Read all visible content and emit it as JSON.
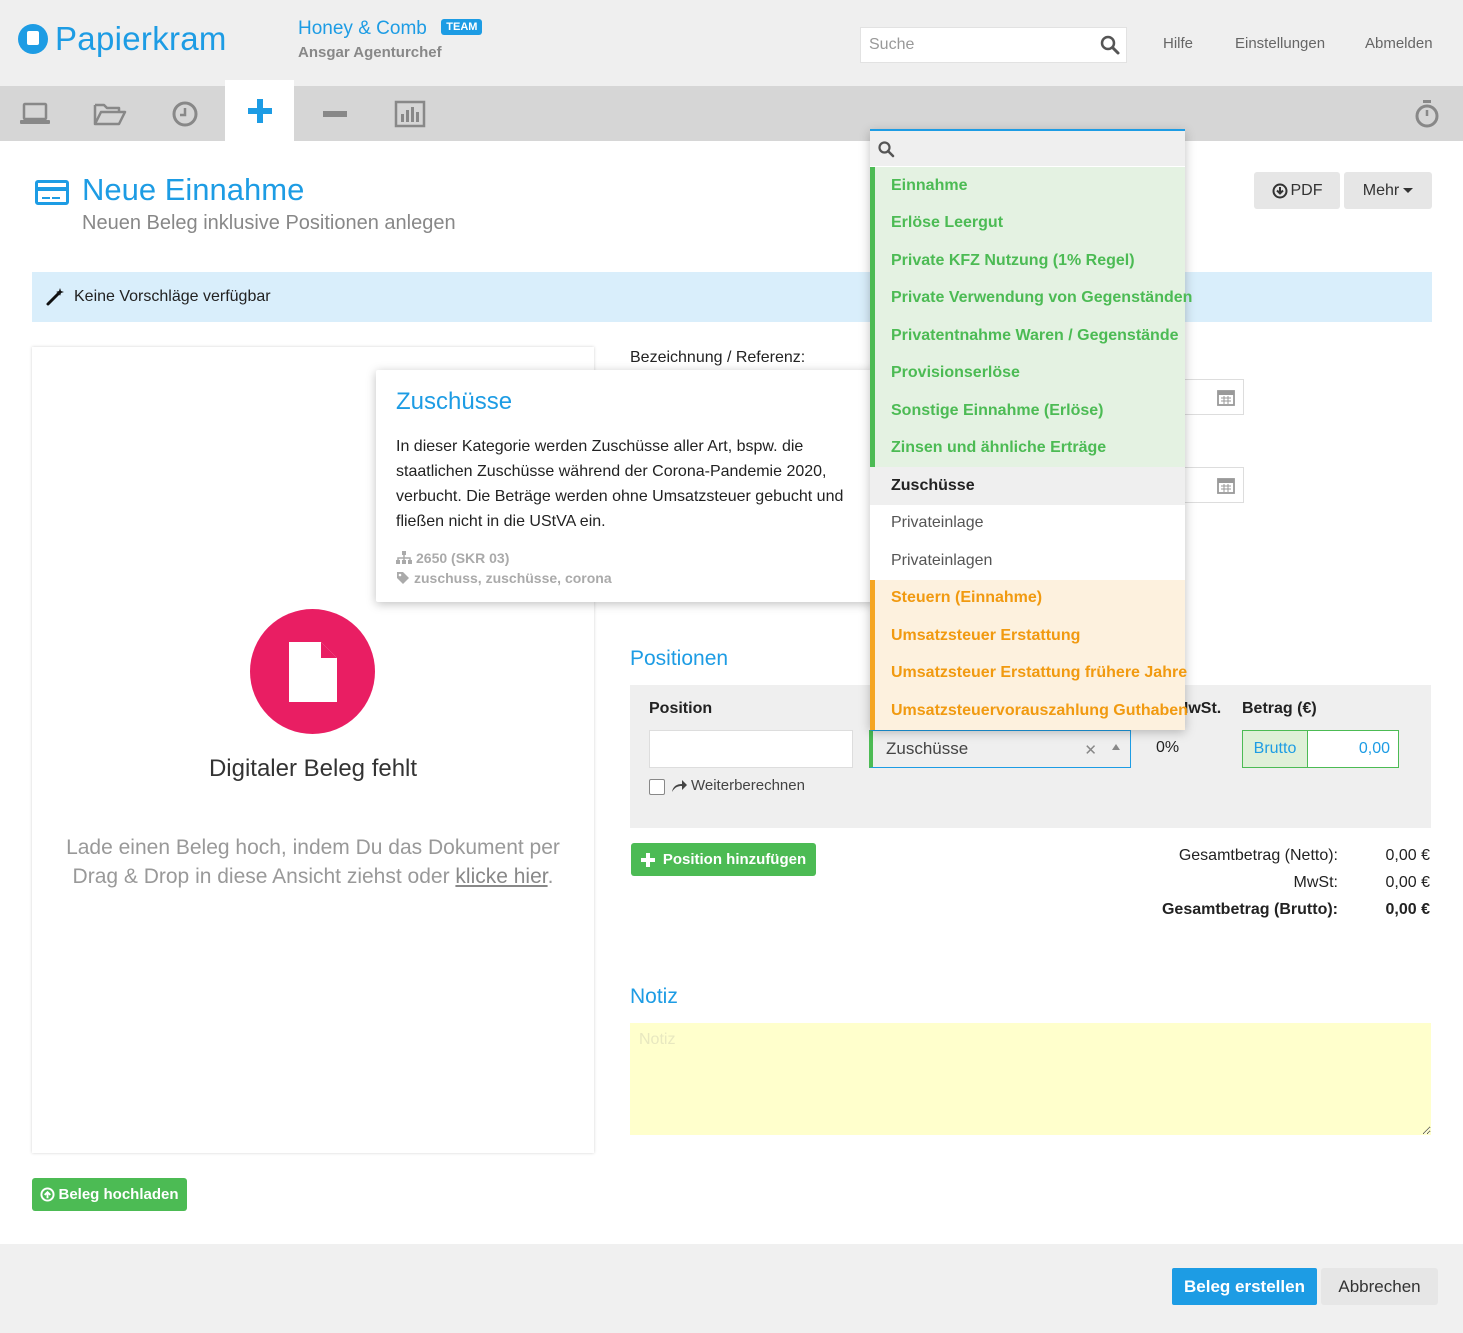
{
  "header": {
    "logo_text": "Papierkram",
    "company_name": "Honey & Comb",
    "team_badge": "TEAM",
    "user_name": "Ansgar Agenturchef",
    "search_placeholder": "Suche",
    "links": [
      "Hilfe",
      "Einstellungen",
      "Abmelden"
    ]
  },
  "toolbar": {
    "items": [
      "laptop-icon",
      "folder-open-icon",
      "clock-icon",
      "plus-icon",
      "minus-icon",
      "bar-chart-icon"
    ],
    "active": "plus-icon",
    "right_icon": "stopwatch-icon"
  },
  "page": {
    "title": "Neue Einnahme",
    "subtitle": "Neuen Beleg inklusive Positionen anlegen",
    "pdf_button": "PDF",
    "more_button": "Mehr"
  },
  "suggestion": {
    "text": "Keine Vorschläge verfügbar"
  },
  "upload": {
    "missing_title": "Digitaler Beleg fehlt",
    "hint_text": "Lade einen Beleg hoch, indem Du das Dokument per Drag & Drop in diese Ansicht ziehst oder ",
    "hint_link": "klicke hier",
    "hint_end": ".",
    "upload_button": "Beleg hochladen"
  },
  "form": {
    "reference_label": "Bezeichnung / Referenz:"
  },
  "positions": {
    "title": "Positionen",
    "col_position": "Position",
    "col_mwst": "MwSt.",
    "col_betrag": "Betrag (€)",
    "position_value": "",
    "category_value": "Zuschüsse",
    "mwst_value": "0%",
    "brutto_label": "Brutto",
    "amount_value": "0,00",
    "recalc_label": "Weiterberechnen",
    "add_button": "Position hinzufügen"
  },
  "totals": {
    "net_label": "Gesamtbetrag (Netto):",
    "net_value": "0,00 €",
    "vat_label": "MwSt:",
    "vat_value": "0,00 €",
    "gross_label": "Gesamtbetrag (Brutto):",
    "gross_value": "0,00 €"
  },
  "note": {
    "title": "Notiz",
    "placeholder": "Notiz",
    "value": ""
  },
  "popover": {
    "title": "Zuschüsse",
    "body": "In dieser Kategorie werden Zuschüsse aller Art, bspw. die staatlichen Zuschüsse während der Corona-Pandemie 2020, verbucht. Die Beträge werden ohne Umsatzsteuer gebucht und fließen nicht in die UStVA ein.",
    "account": "2650 (SKR 03)",
    "tags": "zuschuss, zuschüsse, corona"
  },
  "dropdown": {
    "search_value": "",
    "items": [
      {
        "label": "Einnahme",
        "group": "green"
      },
      {
        "label": "Erlöse Leergut",
        "group": "green"
      },
      {
        "label": "Private KFZ Nutzung (1% Regel)",
        "group": "green"
      },
      {
        "label": "Private Verwendung von Gegenständen",
        "group": "green"
      },
      {
        "label": "Privatentnahme Waren / Gegenstände",
        "group": "green"
      },
      {
        "label": "Provisionserlöse",
        "group": "green"
      },
      {
        "label": "Sonstige Einnahme (Erlöse)",
        "group": "green"
      },
      {
        "label": "Zinsen und ähnliche Erträge",
        "group": "green"
      },
      {
        "label": "Zuschüsse",
        "group": "hl"
      },
      {
        "label": "Privateinlage",
        "group": "plain"
      },
      {
        "label": "Privateinlagen",
        "group": "plain"
      },
      {
        "label": "Steuern (Einnahme)",
        "group": "orange"
      },
      {
        "label": "Umsatzsteuer Erstattung",
        "group": "orange"
      },
      {
        "label": "Umsatzsteuer Erstattung frühere Jahre",
        "group": "orange"
      },
      {
        "label": "Umsatzsteuervorauszahlung Guthaben",
        "group": "orange"
      }
    ]
  },
  "footer": {
    "create_button": "Beleg erstellen",
    "cancel_button": "Abbrechen"
  },
  "colors": {
    "brand_blue": "#1d9ce4",
    "green": "#4cbb54",
    "orange": "#f19a10",
    "pink": "#e91e63",
    "note_yellow": "#ffffcc"
  }
}
